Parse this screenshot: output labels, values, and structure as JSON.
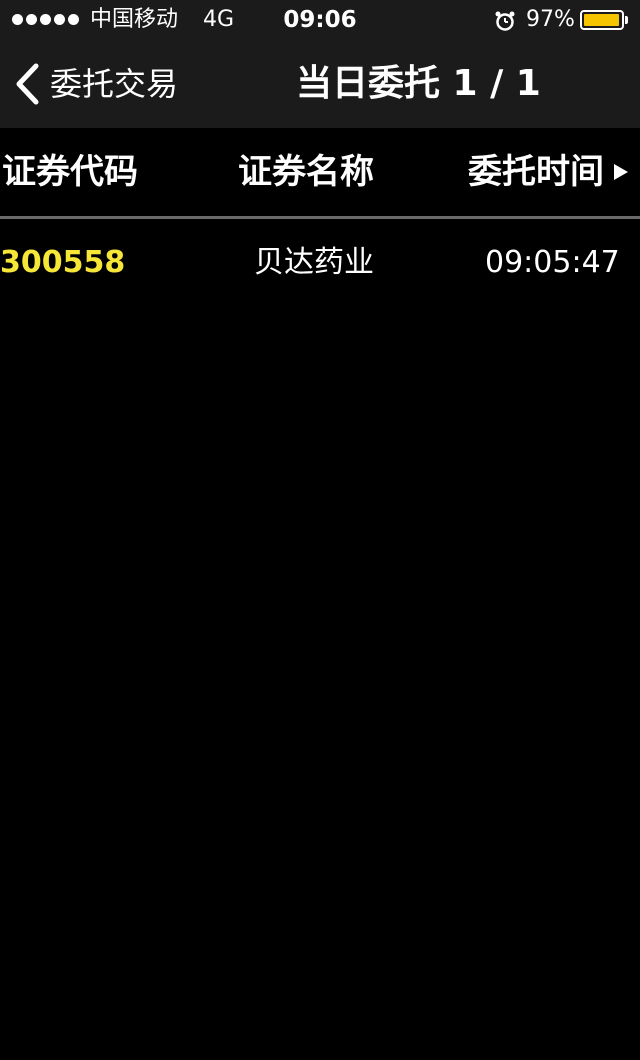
{
  "status_bar": {
    "carrier": "中国移动",
    "network": "4G",
    "time": "09:06",
    "battery_percent": "97%",
    "battery_level": 0.97,
    "battery_color": "#f5c500",
    "icons": [
      "signal-dots-icon",
      "alarm-clock-icon",
      "battery-icon"
    ]
  },
  "nav": {
    "back_label": "委托交易",
    "title": "当日委托 1 / 1"
  },
  "table": {
    "headers": [
      "证券代码",
      "证券名称",
      "委托时间"
    ],
    "rows": [
      {
        "code": "300558",
        "name": "贝达药业",
        "time": "09:05:47"
      }
    ],
    "code_color": "#f5e637"
  }
}
